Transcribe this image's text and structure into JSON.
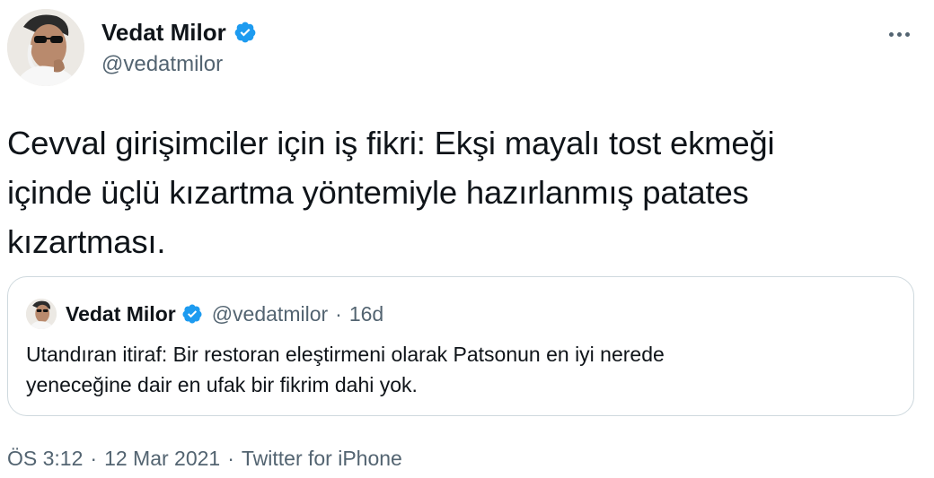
{
  "author": {
    "name": "Vedat Milor",
    "handle": "@vedatmilor",
    "avatar_icon": "person-with-glasses-avatar",
    "verified_icon": "verified-badge-icon",
    "verified_color": "#1d9bf0"
  },
  "menu": {
    "icon": "more-options-icon"
  },
  "tweet": {
    "text": "Cevval girişimciler için iş fikri: Ekşi mayalı tost ekmeği\niçinde üçlü kızartma yöntemiyle hazırlanmış patates\nkızartması."
  },
  "quote": {
    "name": "Vedat Milor",
    "handle": "@vedatmilor",
    "separator": "·",
    "time": "16d",
    "text": "Utandıran itiraf: Bir restoran eleştirmeni olarak Patsonun en iyi nerede\nyeneceğine dair en ufak bir fikrim dahi yok."
  },
  "meta": {
    "time": "ÖS 3:12",
    "separator": "·",
    "date": "12 Mar 2021",
    "source": "Twitter for iPhone"
  },
  "colors": {
    "text": "#0f1419",
    "secondary": "#536471",
    "border": "#cfd9de",
    "verified": "#1d9bf0"
  }
}
